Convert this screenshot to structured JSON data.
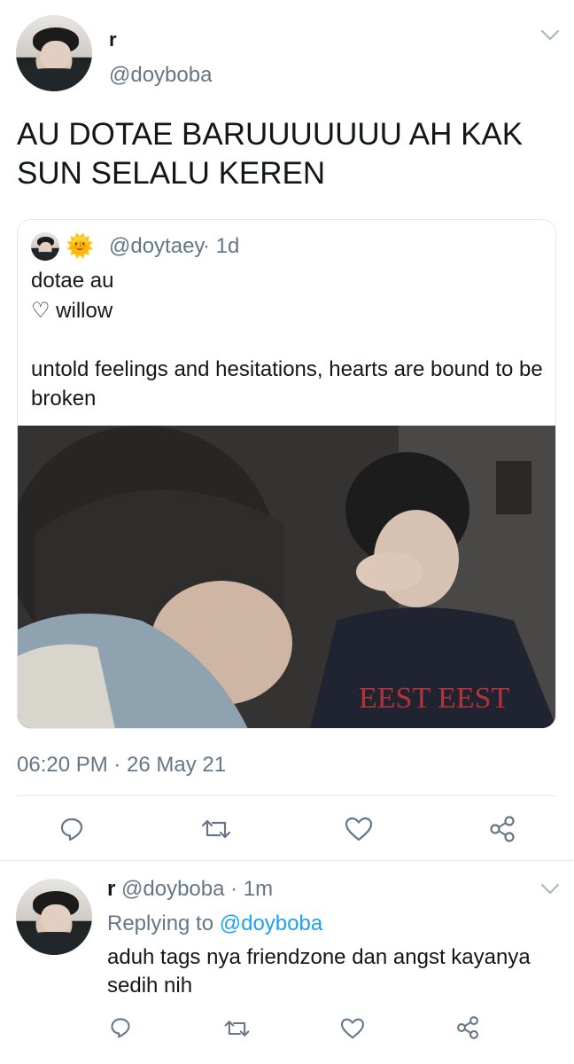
{
  "tweet": {
    "display_name": "r",
    "handle": "@doyboba",
    "text": "AU DOTAE BARUUUUUUU AH KAK SUN SELALU KEREN",
    "timestamp": "06:20 PM · 26 May 21"
  },
  "quoted": {
    "emoji": "🌞",
    "handle": "@doytaey",
    "time": "· 1d",
    "line1": "dotae au",
    "line2": "♡ willow",
    "line3": "untold feelings and hesitations, hearts are bound to be broken"
  },
  "reply": {
    "display_name": "r",
    "handle": "@doyboba",
    "time": "· 1m",
    "replying_prefix": "Replying to",
    "replying_to": "@doyboba",
    "text": "aduh tags nya friendzone dan angst kayanya sedih nih"
  },
  "icons": {
    "reply": "comment-icon",
    "retweet": "retweet-icon",
    "like": "heart-icon",
    "share": "share-icon",
    "menu": "chevron-down-icon"
  },
  "colors": {
    "link": "#1da1f2",
    "muted": "#657786",
    "divider": "#e1e8ed"
  }
}
